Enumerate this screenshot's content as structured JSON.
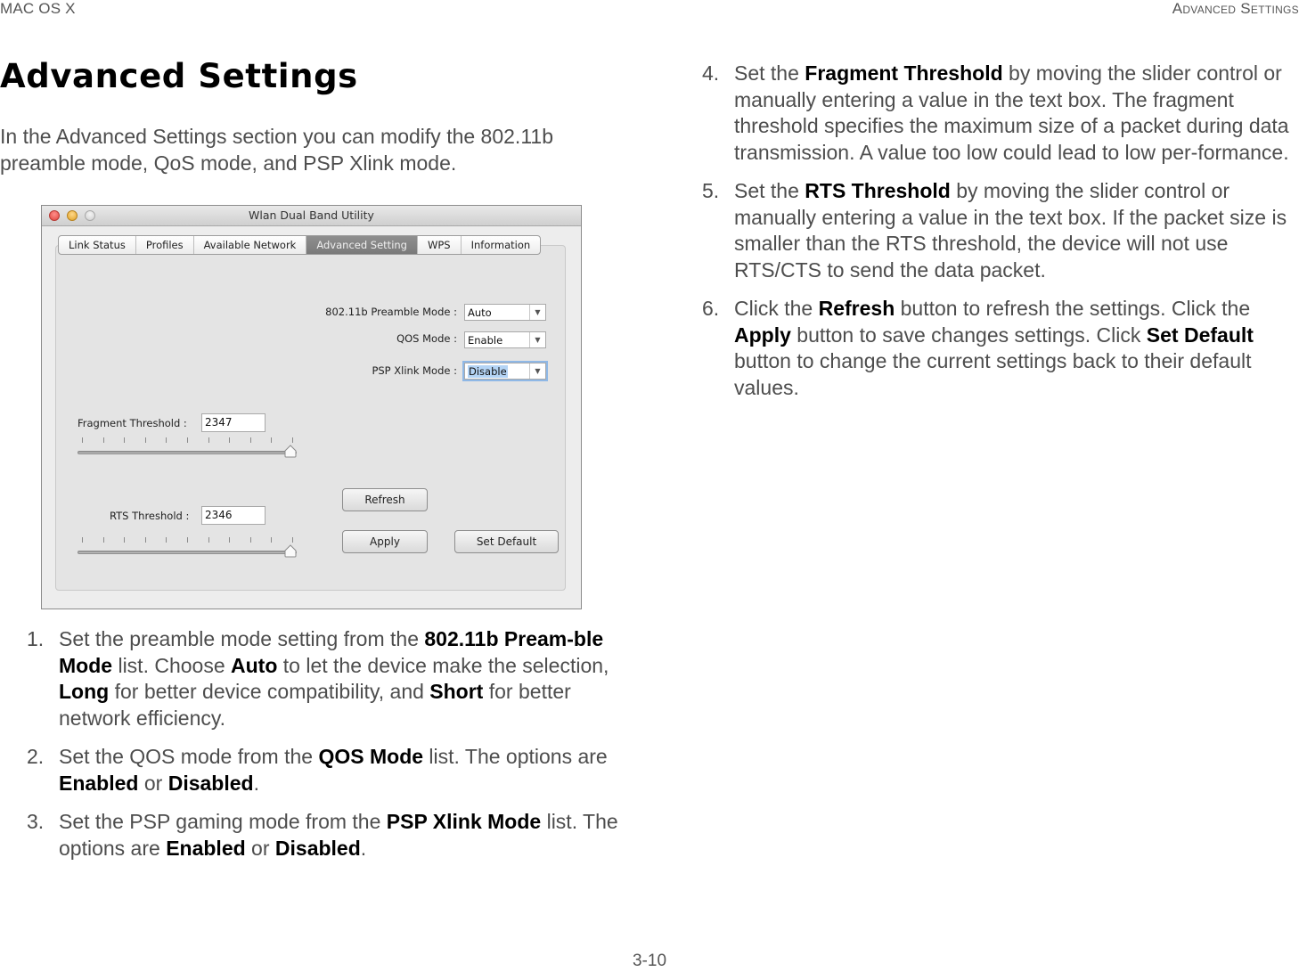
{
  "header": {
    "left": "MAC OS X",
    "right": "Advanced Settings"
  },
  "page_number": "3-10",
  "title": "Advanced Settings",
  "intro": "In the Advanced Settings section you can modify the 802.11b preamble mode, QoS mode, and PSP Xlink mode.",
  "screenshot": {
    "window_title": "Wlan Dual Band Utility",
    "window_controls": [
      "close",
      "minimize",
      "zoom"
    ],
    "tabs": [
      {
        "label": "Link Status",
        "active": false
      },
      {
        "label": "Profiles",
        "active": false
      },
      {
        "label": "Available Network",
        "active": false
      },
      {
        "label": "Advanced Setting",
        "active": true
      },
      {
        "label": "WPS",
        "active": false
      },
      {
        "label": "Information",
        "active": false
      }
    ],
    "preamble": {
      "label": "802.11b  Preamble Mode :",
      "value": "Auto"
    },
    "qos": {
      "label": "QOS Mode :",
      "value": "Enable"
    },
    "psp": {
      "label": "PSP Xlink Mode :",
      "value": "Disable"
    },
    "fragment": {
      "label": "Fragment Threshold :",
      "value": "2347",
      "slider_fraction": 1.0
    },
    "rts": {
      "label": "RTS Threshold :",
      "value": "2346",
      "slider_fraction": 1.0
    },
    "buttons": {
      "refresh": "Refresh",
      "apply": "Apply",
      "set_default": "Set Default"
    },
    "dropdown_arrow": "▼"
  },
  "steps": [
    {
      "num": "1.",
      "parts": [
        {
          "t": "Set the preamble mode setting from the "
        },
        {
          "t": "802.11b Pream-ble Mode",
          "b": true
        },
        {
          "t": " list. Choose "
        },
        {
          "t": "Auto",
          "b": true
        },
        {
          "t": " to let the device make the selection, "
        },
        {
          "t": "Long",
          "b": true
        },
        {
          "t": " for better device compatibility, and "
        },
        {
          "t": "Short",
          "b": true
        },
        {
          "t": " for better network efficiency."
        }
      ]
    },
    {
      "num": "2.",
      "parts": [
        {
          "t": "Set the QOS mode from the "
        },
        {
          "t": "QOS Mode",
          "b": true
        },
        {
          "t": " list. The options are "
        },
        {
          "t": "Enabled",
          "b": true
        },
        {
          "t": " or "
        },
        {
          "t": "Disabled",
          "b": true
        },
        {
          "t": "."
        }
      ]
    },
    {
      "num": "3.",
      "parts": [
        {
          "t": "Set the PSP gaming mode from the "
        },
        {
          "t": "PSP Xlink Mode",
          "b": true
        },
        {
          "t": " list. The options are "
        },
        {
          "t": "Enabled",
          "b": true
        },
        {
          "t": " or "
        },
        {
          "t": "Disabled",
          "b": true
        },
        {
          "t": "."
        }
      ]
    },
    {
      "num": "4.",
      "parts": [
        {
          "t": "Set the "
        },
        {
          "t": "Fragment Threshold",
          "b": true
        },
        {
          "t": " by moving the slider control or manually entering a value in the text box. The fragment threshold specifies the maximum size of a packet during data transmission. A value too low could lead to low per-formance."
        }
      ]
    },
    {
      "num": "5.",
      "parts": [
        {
          "t": "Set the "
        },
        {
          "t": "RTS Threshold",
          "b": true
        },
        {
          "t": " by moving the slider control or manually entering a value in the text box. If the packet size is smaller than the RTS threshold, the device will not use RTS/CTS to send the data packet."
        }
      ]
    },
    {
      "num": "6.",
      "parts": [
        {
          "t": "Click the "
        },
        {
          "t": "Refresh",
          "b": true
        },
        {
          "t": " button to refresh the settings. Click the "
        },
        {
          "t": "Apply",
          "b": true
        },
        {
          "t": " button to save changes settings. Click "
        },
        {
          "t": "Set Default",
          "b": true
        },
        {
          "t": " button to change the current settings back to their default values."
        }
      ]
    }
  ]
}
